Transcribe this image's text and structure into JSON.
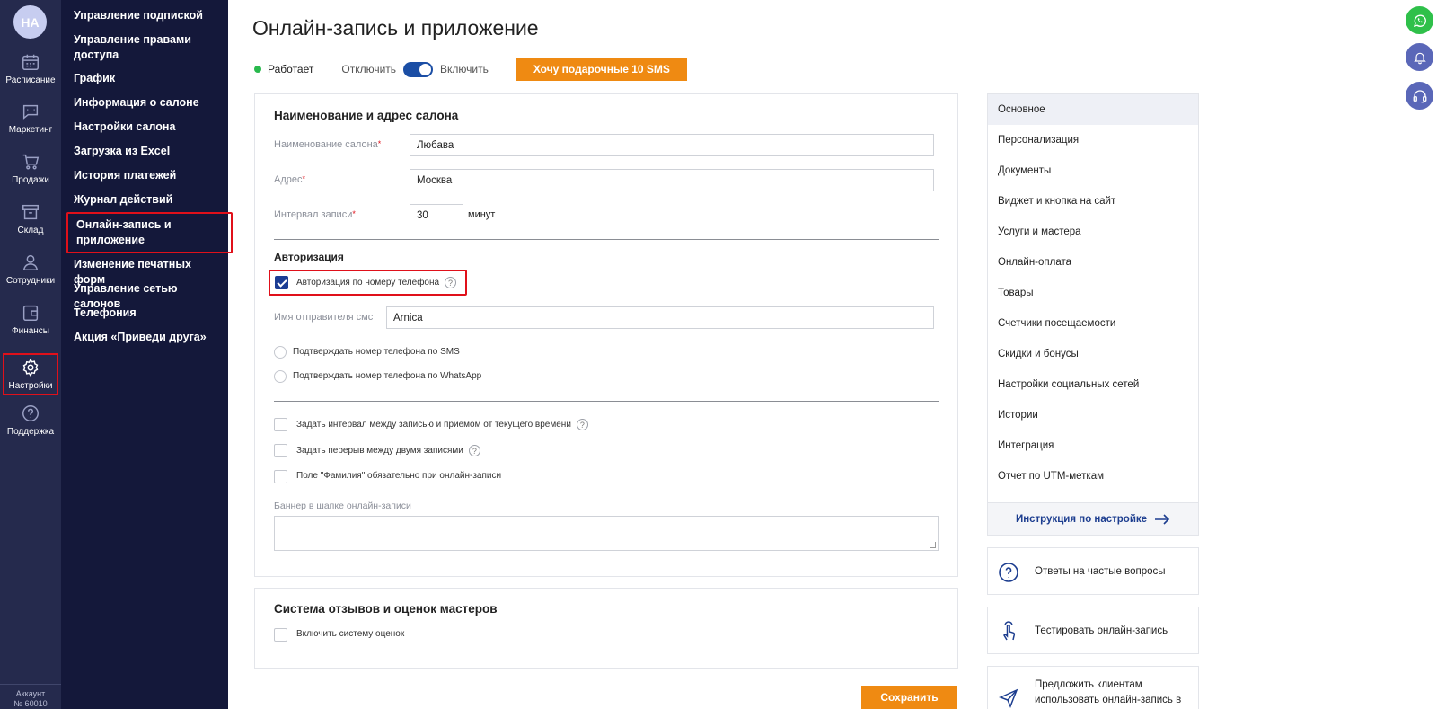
{
  "account": {
    "initials": "НА",
    "label": "Аккаунт",
    "number": "№ 60010"
  },
  "rail": [
    {
      "label": "Расписание",
      "icon": "calendar-icon"
    },
    {
      "label": "Маркетинг",
      "icon": "chat-icon"
    },
    {
      "label": "Продажи",
      "icon": "cart-icon"
    },
    {
      "label": "Склад",
      "icon": "box-icon"
    },
    {
      "label": "Сотрудники",
      "icon": "user-icon"
    },
    {
      "label": "Финансы",
      "icon": "wallet-icon"
    },
    {
      "label": "Настройки",
      "icon": "gear-icon",
      "active": true
    },
    {
      "label": "Поддержка",
      "icon": "help-icon"
    }
  ],
  "submenu": [
    "Управление подпиской",
    "Управление правами доступа",
    "График",
    "Информация о салоне",
    "Настройки салона",
    "Загрузка из Excel",
    "История платежей",
    "Журнал действий",
    "Онлайн-запись и приложение",
    "Изменение печатных форм",
    "Управление сетью салонов",
    "Телефония",
    "Акция «Приведи друга»"
  ],
  "page": {
    "title": "Онлайн-запись и приложение",
    "status": "Работает",
    "off_label": "Отключить",
    "on_label": "Включить",
    "gift_button": "Хочу подарочные 10 SMS",
    "save_button": "Сохранить"
  },
  "salon": {
    "section_title": "Наименование и адрес салона",
    "name_label": "Наименование салона",
    "name_value": "Любава",
    "address_label": "Адрес",
    "address_value": "Москва",
    "interval_label": "Интервал записи",
    "interval_value": "30",
    "interval_unit": "минут"
  },
  "auth": {
    "section_title": "Авторизация",
    "phone_auth_label": "Авторизация по номеру телефона",
    "phone_auth_checked": true,
    "sender_label": "Имя отправителя смс",
    "sender_value": "Arnica",
    "confirm_sms": "Подтверждать номер телефона по SMS",
    "confirm_whatsapp": "Подтверждать номер телефона по WhatsApp"
  },
  "options": {
    "interval_from_now": "Задать интервал между записью и приемом от текущего времени",
    "break_between": "Задать перерыв между двумя записями",
    "surname_required": "Поле \"Фамилия\" обязательно при онлайн-записи",
    "banner_label": "Баннер в шапке онлайн-записи"
  },
  "reviews": {
    "section_title": "Система отзывов и оценок мастеров",
    "enable_label": "Включить систему оценок"
  },
  "rnav": {
    "items": [
      "Основное",
      "Персонализация",
      "Документы",
      "Виджет и кнопка на сайт",
      "Услуги и мастера",
      "Онлайн-оплата",
      "Товары",
      "Счетчики посещаемости",
      "Скидки и бонусы",
      "Настройки социальных сетей",
      "Истории",
      "Интеграция",
      "Отчет по UTM-меткам"
    ],
    "footer": "Инструкция по настройке"
  },
  "rcards": {
    "faq": "Ответы на частые вопросы",
    "test": "Тестировать онлайн-запись",
    "offer_line1": "Предложить клиентам",
    "offer_line2": "использовать онлайн-запись в"
  },
  "colors": {
    "accent": "#ef8a12",
    "primary": "#1b3d94",
    "rail_bg": "#252a4d",
    "submenu_bg": "#14183a",
    "highlight": "#e0101a"
  }
}
